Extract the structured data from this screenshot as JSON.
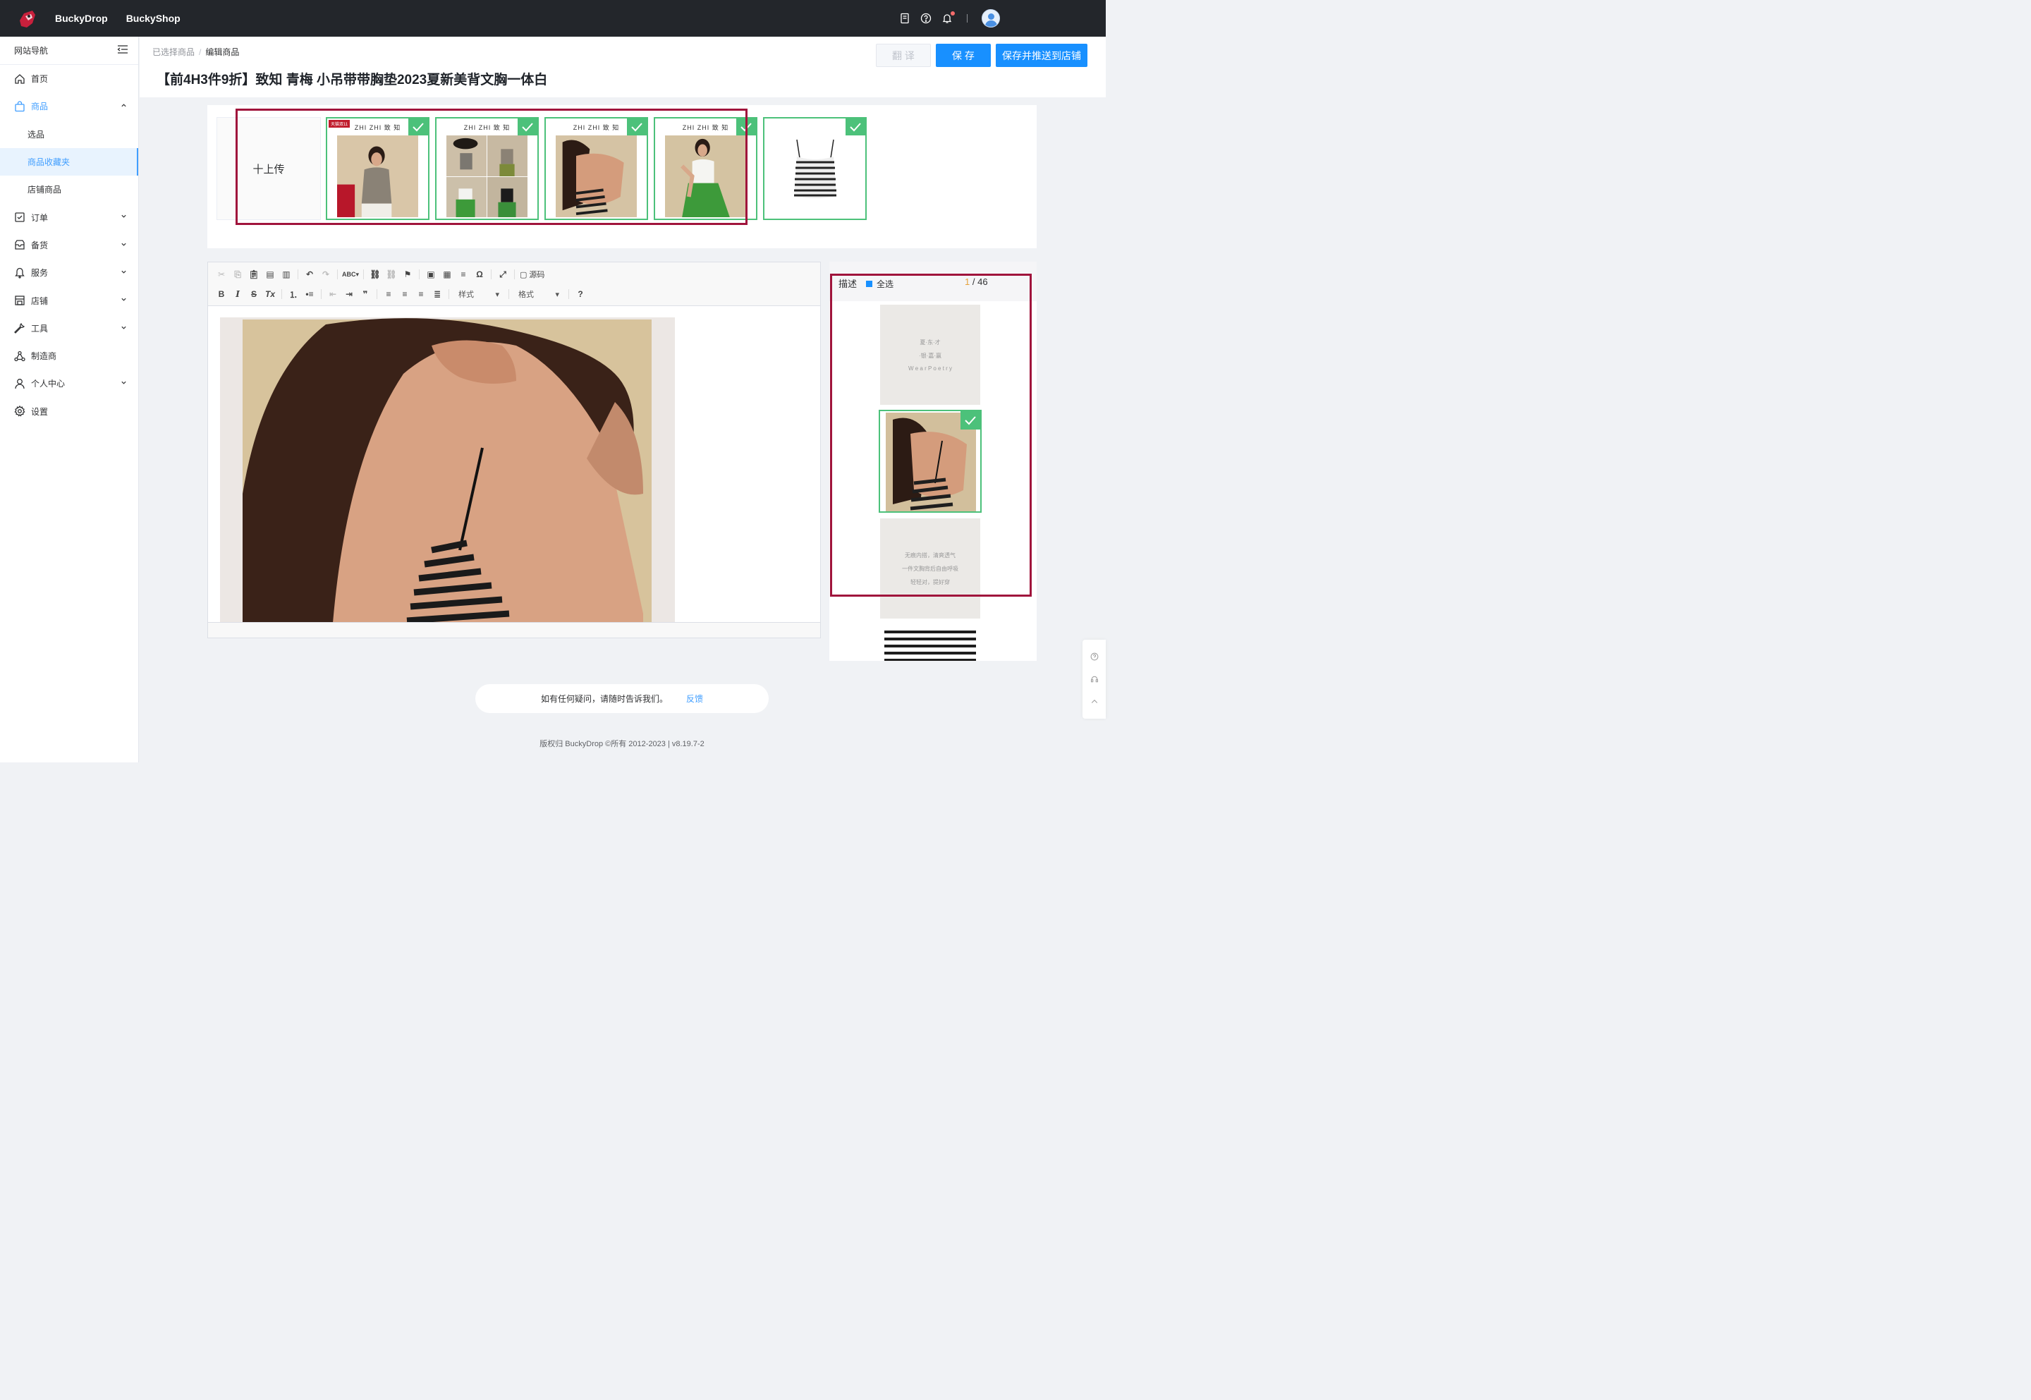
{
  "topbar": {
    "brands": [
      "BuckyDrop",
      "BuckyShop"
    ],
    "icons": [
      "document-icon",
      "help-icon",
      "bell-icon",
      "avatar"
    ]
  },
  "sidebar": {
    "title": "网站导航",
    "items": [
      {
        "label": "首页",
        "icon": "home-icon"
      },
      {
        "label": "商品",
        "icon": "bag-icon",
        "expanded": true
      },
      {
        "label": "选品",
        "sub": true
      },
      {
        "label": "商品收藏夹",
        "sub": true,
        "selected": true
      },
      {
        "label": "店铺商品",
        "sub": true
      },
      {
        "label": "订单",
        "icon": "order-icon"
      },
      {
        "label": "备货",
        "icon": "stock-icon"
      },
      {
        "label": "服务",
        "icon": "service-icon"
      },
      {
        "label": "店铺",
        "icon": "store-icon"
      },
      {
        "label": "工具",
        "icon": "tool-icon"
      },
      {
        "label": "制造商",
        "icon": "manufacturer-icon"
      },
      {
        "label": "个人中心",
        "icon": "user-icon"
      },
      {
        "label": "设置",
        "icon": "settings-icon"
      }
    ]
  },
  "header": {
    "breadcrumb": [
      "已选择商品",
      "编辑商品"
    ],
    "title": "【前4H3件9折】致知 青梅 小吊带带胸垫2023夏新美背文胸一体白",
    "translate_label": "翻 译",
    "save_label": "保 存",
    "push_label": "保存并推送到店铺"
  },
  "images": {
    "upload_label": "十上传",
    "brand_text": "ZHI ZHI 致 知",
    "thumbs": [
      {
        "checked": true,
        "badge": "天猫双11"
      },
      {
        "checked": true
      },
      {
        "checked": true
      },
      {
        "checked": true
      },
      {
        "checked": true
      }
    ]
  },
  "editor": {
    "style_label": "样式",
    "format_label": "格式",
    "source_label": "源码"
  },
  "description": {
    "title": "描述",
    "select_all": "全选",
    "current": "1",
    "total": "/ 46",
    "thumb1_lines": [
      "夏·东·才",
      "·银·嘉·赢",
      "W e a r P o e t r y"
    ],
    "thumb3_lines": [
      "无痕内搭，清爽透气",
      "一件文胸背后自由呼吸",
      "轻轻对，提好穿"
    ]
  },
  "feedback": {
    "text": "如有任何疑问，请随时告诉我们。",
    "link": "反馈"
  },
  "footer": {
    "copyright": "版权归 BuckyDrop ©所有 2012-2023 | v8.19.7-2"
  },
  "colors": {
    "accent": "#1890ff",
    "check": "#4cc17a",
    "highlight": "#a0143c",
    "topbar": "#23262b"
  }
}
